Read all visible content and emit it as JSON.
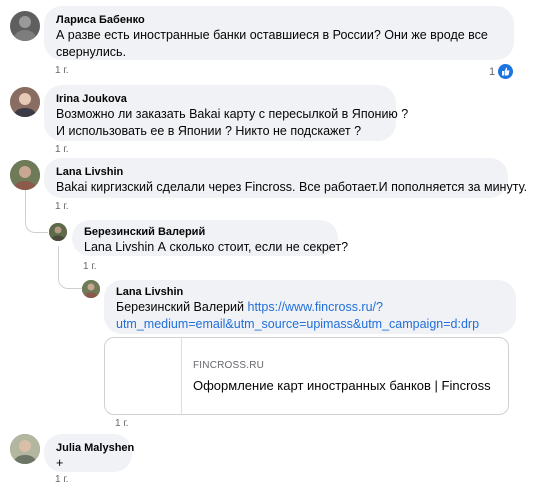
{
  "comments": [
    {
      "author": "Лариса Бабенко",
      "line1": "А разве есть иностранные банки оставшиеся в России? Они же вроде все",
      "line2": "свернулись.",
      "time": "1 г.",
      "reaction_count": "1"
    },
    {
      "author": "Irina Joukova",
      "line1": "Возможно ли заказать Bakai карту с пересылкой в Японию ?",
      "line2": "И использовать ее в Японии ? Никто не подскажет ?",
      "time": "1 г."
    },
    {
      "author": "Lana Livshin",
      "line1": "Bakai киргизский сделали через Fincross. Все работает.И пополняется за минуту.",
      "time": "1 г."
    },
    {
      "author": "Березинский Валерий",
      "line1": "Lana Livshin А сколько стоит, если не секрет?",
      "time": "1 г."
    },
    {
      "author": "Lana Livshin",
      "mention": "Березинский Валерий",
      "link1": "https://www.fincross.ru/?",
      "link2": "utm_medium=email&utm_source=upimass&utm_campaign=d:drp",
      "time": "1 г."
    },
    {
      "author": "Julia Malyshen",
      "line1": "+",
      "time": "1 г."
    }
  ],
  "link_preview": {
    "domain": "FINCROSS.RU",
    "title": "Оформление карт иностранных банков | Fincross"
  },
  "colors": {
    "bubble": "#f0f2f5",
    "link": "#216fdb",
    "like_badge": "#1b74e4",
    "meta_text": "#65676b"
  },
  "icons": {
    "like": "thumbs-up-icon"
  }
}
